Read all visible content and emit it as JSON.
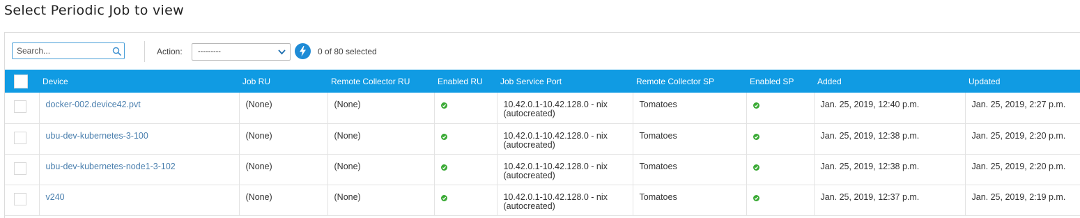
{
  "page": {
    "title": "Select Periodic Job to view"
  },
  "toolbar": {
    "search_placeholder": "Search...",
    "action_label": "Action:",
    "action_selected": "---------",
    "selected_count": "0 of 80 selected"
  },
  "table": {
    "columns": [
      "Device",
      "Job RU",
      "Remote Collector RU",
      "Enabled RU",
      "Job Service Port",
      "Remote Collector SP",
      "Enabled SP",
      "Added",
      "Updated"
    ],
    "rows": [
      {
        "device": "docker-002.device42.pvt",
        "job_ru": "(None)",
        "remote_collector_ru": "(None)",
        "enabled_ru": true,
        "job_service_port": "10.42.0.1-10.42.128.0 - nix (autocreated)",
        "remote_collector_sp": "Tomatoes",
        "enabled_sp": true,
        "added": "Jan. 25, 2019, 12:40 p.m.",
        "updated": "Jan. 25, 2019, 2:27 p.m."
      },
      {
        "device": "ubu-dev-kubernetes-3-100",
        "job_ru": "(None)",
        "remote_collector_ru": "(None)",
        "enabled_ru": true,
        "job_service_port": "10.42.0.1-10.42.128.0 - nix (autocreated)",
        "remote_collector_sp": "Tomatoes",
        "enabled_sp": true,
        "added": "Jan. 25, 2019, 12:38 p.m.",
        "updated": "Jan. 25, 2019, 2:20 p.m."
      },
      {
        "device": "ubu-dev-kubernetes-node1-3-102",
        "job_ru": "(None)",
        "remote_collector_ru": "(None)",
        "enabled_ru": true,
        "job_service_port": "10.42.0.1-10.42.128.0 - nix (autocreated)",
        "remote_collector_sp": "Tomatoes",
        "enabled_sp": true,
        "added": "Jan. 25, 2019, 12:38 p.m.",
        "updated": "Jan. 25, 2019, 2:20 p.m."
      },
      {
        "device": "v240",
        "job_ru": "(None)",
        "remote_collector_ru": "(None)",
        "enabled_ru": true,
        "job_service_port": "10.42.0.1-10.42.128.0 - nix (autocreated)",
        "remote_collector_sp": "Tomatoes",
        "enabled_sp": true,
        "added": "Jan. 25, 2019, 12:37 p.m.",
        "updated": "Jan. 25, 2019, 2:19 p.m."
      }
    ]
  },
  "icons": {
    "search": "search-icon",
    "dropdown": "chevron-down-icon",
    "go": "lightning-bolt-icon",
    "enabled": "green-check-icon"
  },
  "colors": {
    "header_bg": "#109be3",
    "accent": "#1e8bd6",
    "link": "#4a7fae",
    "enabled_green": "#3aaa35"
  }
}
